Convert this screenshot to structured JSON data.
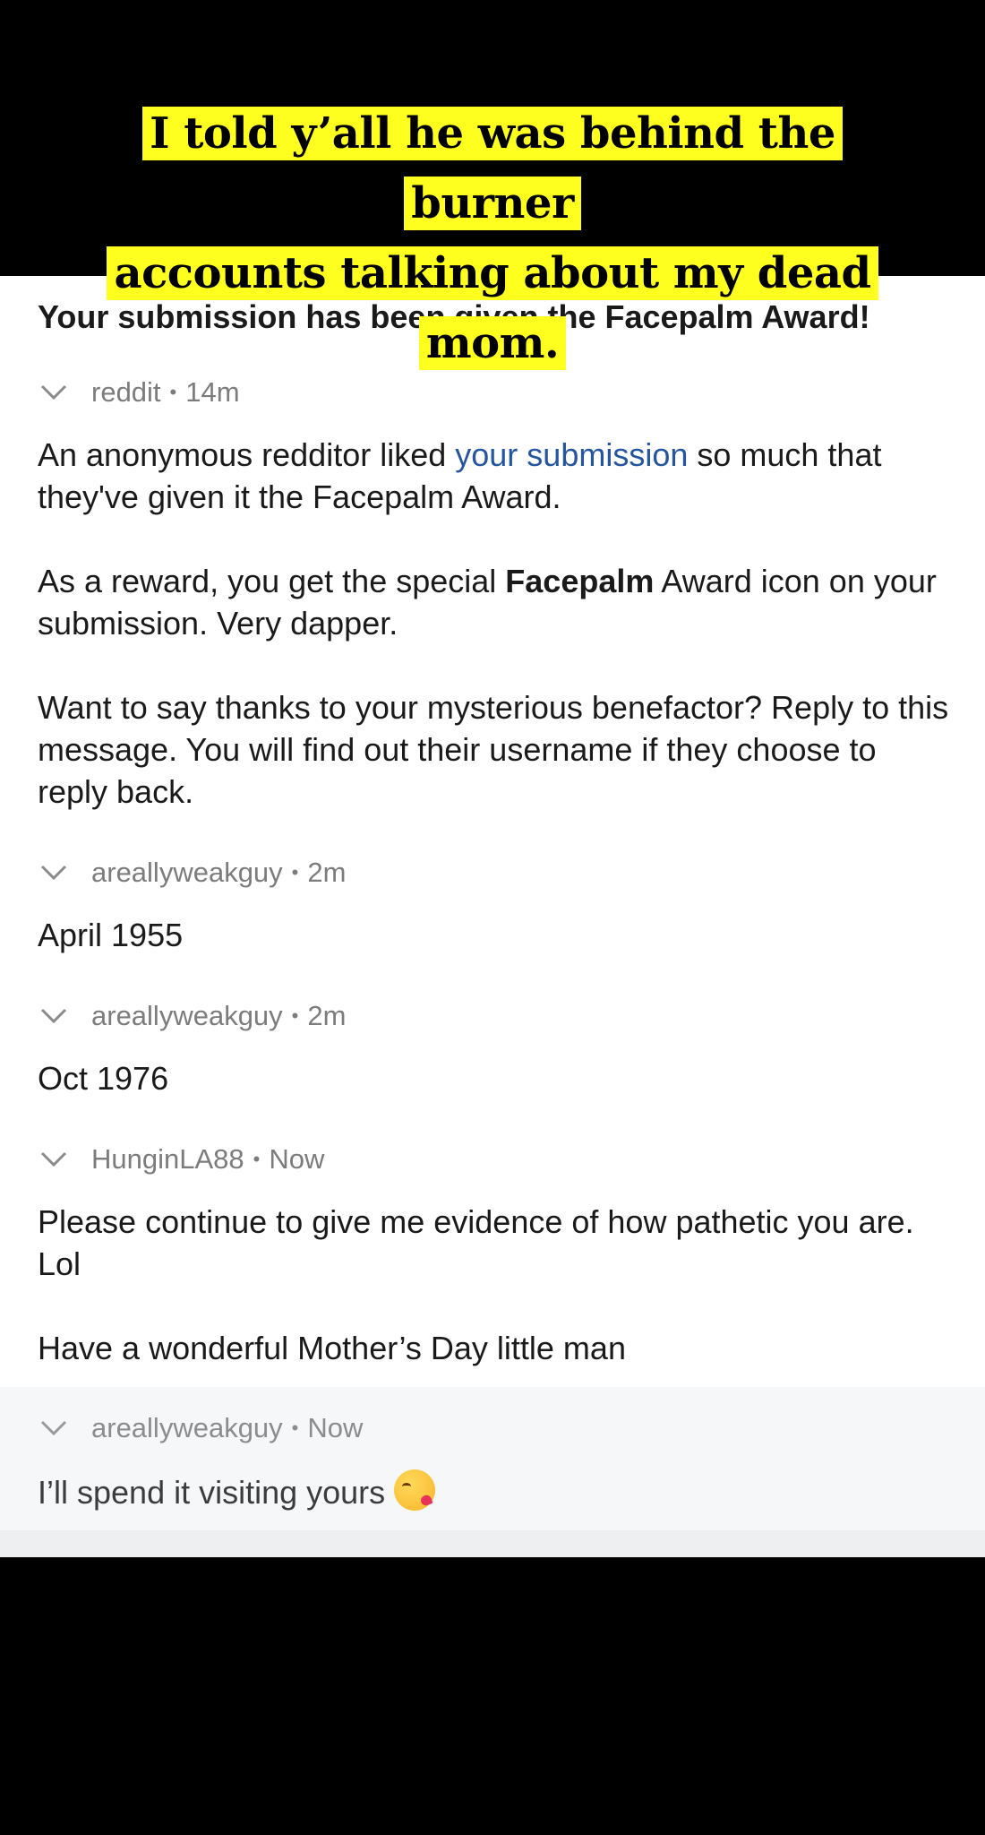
{
  "caption": {
    "line1": "I told y’all he was behind the burner",
    "line2": "accounts talking about my dead",
    "line3": "mom."
  },
  "thread": {
    "subject": "Your submission has been given the Facepalm Award!",
    "messages": [
      {
        "author": "reddit",
        "time": "14m",
        "paragraphs": [
          {
            "before": "An anonymous redditor liked ",
            "link": "your submission",
            "after": " so much that they've given it the Facepalm Award."
          },
          {
            "before": "As a reward, you get the special ",
            "bold": "Facepalm",
            "after": " Award icon on your submission. Very dapper."
          },
          {
            "text": "Want to say thanks to your mysterious benefactor? Reply to this message. You will find out their username if they choose to reply back."
          }
        ]
      },
      {
        "author": "areallyweakguy",
        "time": "2m",
        "text": "April 1955"
      },
      {
        "author": "areallyweakguy",
        "time": "2m",
        "text": "Oct 1976"
      },
      {
        "author": "HunginLA88",
        "time": "Now",
        "paragraphs": [
          "Please continue to give me evidence of how pathetic you are. Lol",
          "Have a wonderful Mother’s Day little man"
        ]
      },
      {
        "author": "areallyweakguy",
        "time": "Now",
        "text": "I’ll spend it visiting yours",
        "emoji": "kissing-face-emoji"
      }
    ],
    "separator": "•",
    "colors": {
      "link": "#24559e",
      "caption_highlight": "#ffff1f",
      "meta": "#7c7c7c"
    }
  }
}
